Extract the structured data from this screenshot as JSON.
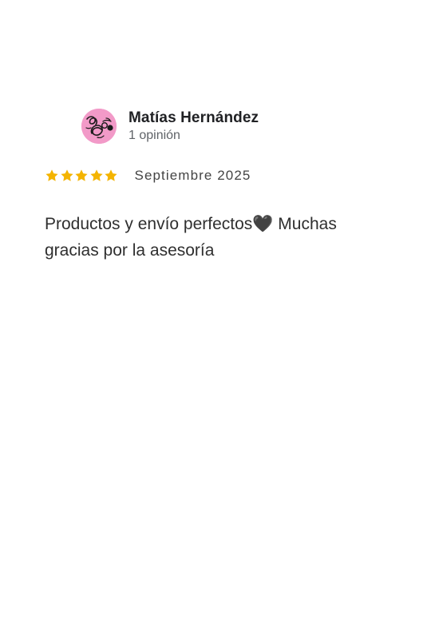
{
  "reviewer": {
    "name": "Matías Hernández",
    "review_count": "1 opinión",
    "avatar_icon": "pink-doodle-avatar",
    "avatar_color": "#f29ac8"
  },
  "review": {
    "rating": 5,
    "rating_max": 5,
    "star_color": "#f4b400",
    "date": "Septiembre 2025",
    "text": "Productos y envío perfectos🖤 Muchas gracias por la asesoría"
  }
}
